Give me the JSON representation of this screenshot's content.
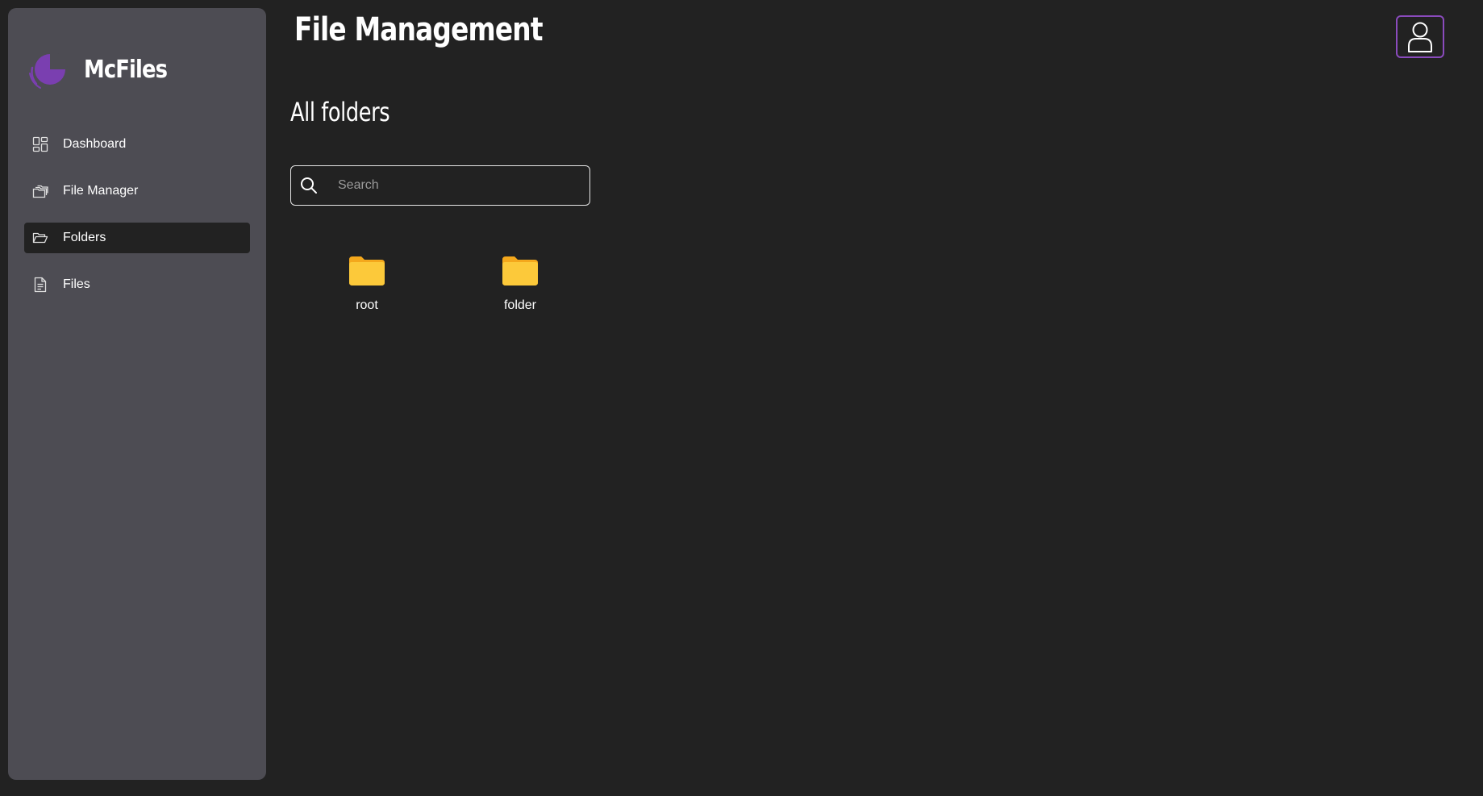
{
  "app": {
    "name": "McFiles",
    "logo_icon": "mcfiles-logo-icon",
    "accent_color": "#8a4bbd"
  },
  "sidebar": {
    "items": [
      {
        "label": "Dashboard",
        "icon": "dashboard-icon",
        "active": false
      },
      {
        "label": "File Manager",
        "icon": "file-manager-icon",
        "active": false
      },
      {
        "label": "Folders",
        "icon": "folder-open-icon",
        "active": true
      },
      {
        "label": "Files",
        "icon": "file-icon",
        "active": false
      }
    ]
  },
  "header": {
    "title": "File Management",
    "user_icon": "user-icon"
  },
  "main": {
    "section_title": "All folders",
    "search": {
      "placeholder": "Search",
      "value": ""
    },
    "folders": [
      {
        "name": "root",
        "icon": "folder-icon",
        "color": "#fbc02d"
      },
      {
        "name": "folder",
        "icon": "folder-icon",
        "color": "#fbc02d"
      }
    ]
  }
}
